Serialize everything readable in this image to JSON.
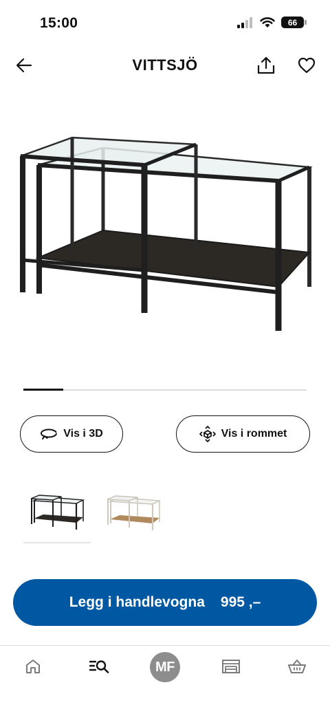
{
  "status_bar": {
    "time": "15:00",
    "battery": "66"
  },
  "header": {
    "title": "VITTSJÖ",
    "back_icon": "arrow-left-icon",
    "share_icon": "share-icon",
    "favorite_icon": "heart-icon"
  },
  "gallery": {
    "progress": 0.14
  },
  "actions": {
    "view_3d_label": "Vis i 3D",
    "view_room_label": "Vis i rommet"
  },
  "variants": [
    {
      "name": "black-brown",
      "color": "#1e1e1e"
    },
    {
      "name": "white-oak",
      "color": "#d8d4cc"
    }
  ],
  "cart": {
    "label": "Legg i handlevogna",
    "price": "995 ,–",
    "color": "#0058a3"
  },
  "bottom_nav": {
    "items": [
      "home-icon",
      "search-icon",
      "profile-avatar",
      "store-icon",
      "cart-icon"
    ],
    "avatar_initials": "MF",
    "active": "search-icon"
  }
}
